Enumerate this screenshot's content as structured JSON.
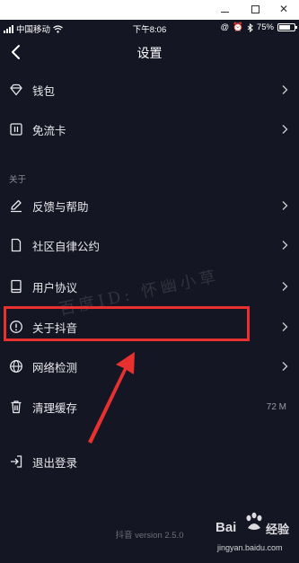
{
  "window": {
    "minimize_icon": "minimize-icon",
    "maximize_icon": "maximize-icon",
    "close_icon": "close-icon"
  },
  "statusbar": {
    "carrier": "中国移动",
    "time": "下午8:06",
    "battery": "75%",
    "battery_level": 0.75
  },
  "navbar": {
    "title": "设置"
  },
  "rows": {
    "wallet": "钱包",
    "free_data": "免流卡",
    "section_about": "关于",
    "feedback": "反馈与帮助",
    "community": "社区自律公约",
    "agreement": "用户协议",
    "about_douyin": "关于抖音",
    "network": "网络检测",
    "cache": "清理缓存",
    "cache_size": "72 M",
    "logout": "退出登录"
  },
  "version": "抖音 version 2.5.0",
  "watermark": "百度ID: 怀幽小草",
  "baidu": {
    "brand": "Bai",
    "jingyan": "经验",
    "url": "jingyan.baidu.com"
  },
  "colors": {
    "background": "#151623",
    "highlight": "#e8312f",
    "text": "#e8e8ec"
  }
}
